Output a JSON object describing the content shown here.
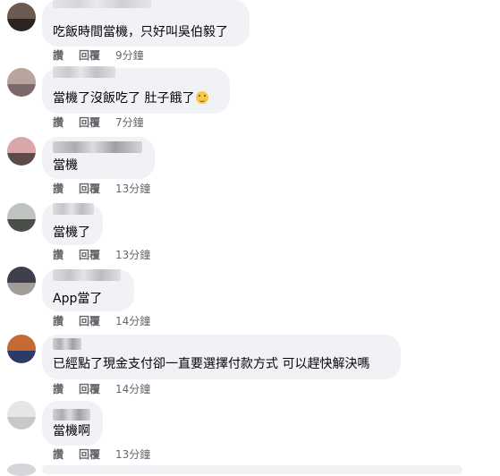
{
  "comments": [
    {
      "text": "吃飯時間當機，只好叫吳伯毅了",
      "like": "讚",
      "reply": "回覆",
      "time": "9分鐘",
      "has_emoji": false,
      "avatar_colors": [
        "#6a5a52",
        "#2b2423"
      ]
    },
    {
      "text": "當機了沒飯吃了 肚子餓了",
      "like": "讚",
      "reply": "回覆",
      "time": "7分鐘",
      "has_emoji": true,
      "emoji_icon": "face-with-hand-over-mouth-icon",
      "avatar_colors": [
        "#b7a49a",
        "#7a6a6a"
      ]
    },
    {
      "text": "當機",
      "like": "讚",
      "reply": "回覆",
      "time": "13分鐘",
      "has_emoji": false,
      "avatar_colors": [
        "#d9a7a7",
        "#5b4b4b"
      ]
    },
    {
      "text": "當機了",
      "like": "讚",
      "reply": "回覆",
      "time": "13分鐘",
      "has_emoji": false,
      "avatar_colors": [
        "#bfc4c0",
        "#4c4e4a"
      ]
    },
    {
      "text": "App當了",
      "like": "讚",
      "reply": "回覆",
      "time": "14分鐘",
      "has_emoji": false,
      "avatar_colors": [
        "#3d3f4c",
        "#a19e9a"
      ]
    },
    {
      "text": "已經點了現金支付卻一直要選擇付款方式 可以趕快解決嗎",
      "like": "讚",
      "reply": "回覆",
      "time": "14分鐘",
      "has_emoji": false,
      "avatar_colors": [
        "#c36b33",
        "#2d3a66"
      ]
    },
    {
      "text": "當機啊",
      "like": "讚",
      "reply": "回覆",
      "time": "13分鐘",
      "has_emoji": false,
      "avatar_colors": [
        "#e6e6e6",
        "#c8c8c8"
      ]
    }
  ],
  "colors": {
    "bubble": "#f0f2f5",
    "text": "#050505",
    "meta": "#65676b"
  }
}
